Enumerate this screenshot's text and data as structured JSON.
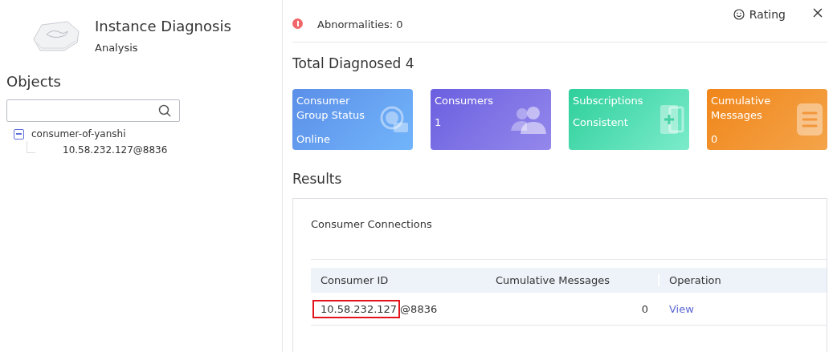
{
  "header": {
    "title": "Instance Diagnosis",
    "subtitle": "Analysis"
  },
  "objects": {
    "title": "Objects",
    "tree": [
      {
        "label": "consumer-of-yanshi",
        "expanded": true,
        "children": [
          {
            "label": "10.58.232.127@8836"
          }
        ]
      }
    ]
  },
  "alert": {
    "text": "Abnormalities: 0"
  },
  "rating": "Rating",
  "total": "Total Diagnosed 4",
  "cards": [
    {
      "kind": "status",
      "title": "Consumer Group Status",
      "value": "Online"
    },
    {
      "kind": "consumers",
      "title": "Consumers",
      "value": "1"
    },
    {
      "kind": "subscriptions",
      "title": "Subscriptions",
      "value": "Consistent"
    },
    {
      "kind": "messages",
      "title": "Cumulative Messages",
      "value": "0"
    }
  ],
  "results": {
    "title": "Results",
    "section": "Consumer Connections",
    "columns": [
      "Consumer ID",
      "Cumulative Messages",
      "Operation"
    ],
    "rows": [
      {
        "consumer_id": [
          "10.58.232.127",
          "@8836"
        ],
        "highlighted": true,
        "messages": "0",
        "operation": "View"
      }
    ]
  }
}
